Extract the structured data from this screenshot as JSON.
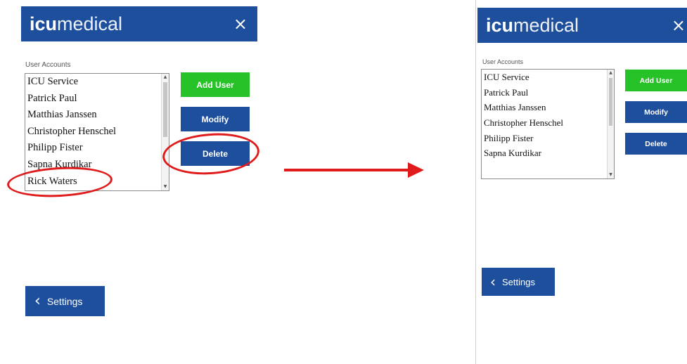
{
  "left": {
    "logo_bold": "icu",
    "logo_light": "medical",
    "close_glyph": "×",
    "caption": "User Accounts",
    "users": [
      "ICU Service",
      "Patrick Paul",
      "Matthias Janssen",
      "Christopher Henschel",
      "Philipp Fister",
      "Sapna Kurdikar",
      "Rick Waters"
    ],
    "buttons": {
      "add": "Add User",
      "modify": "Modify",
      "delete": "Delete"
    },
    "settings": {
      "chevron": "‹",
      "label": "Settings"
    }
  },
  "right": {
    "logo_bold": "icu",
    "logo_light": "medical",
    "close_glyph": "×",
    "caption": "User Accounts",
    "users": [
      "ICU Service",
      "Patrick Paul",
      "Matthias Janssen",
      "Christopher Henschel",
      "Philipp Fister",
      "Sapna Kurdikar"
    ],
    "buttons": {
      "add": "Add User",
      "modify": "Modify",
      "delete": "Delete"
    },
    "settings": {
      "chevron": "‹",
      "label": "Settings"
    }
  },
  "colors": {
    "brand_blue": "#1e4f9c",
    "add_green": "#27c227",
    "annotation_red": "#e01b1b"
  },
  "icons": [
    "close-icon",
    "chevron-left-icon",
    "arrow-right-icon"
  ]
}
